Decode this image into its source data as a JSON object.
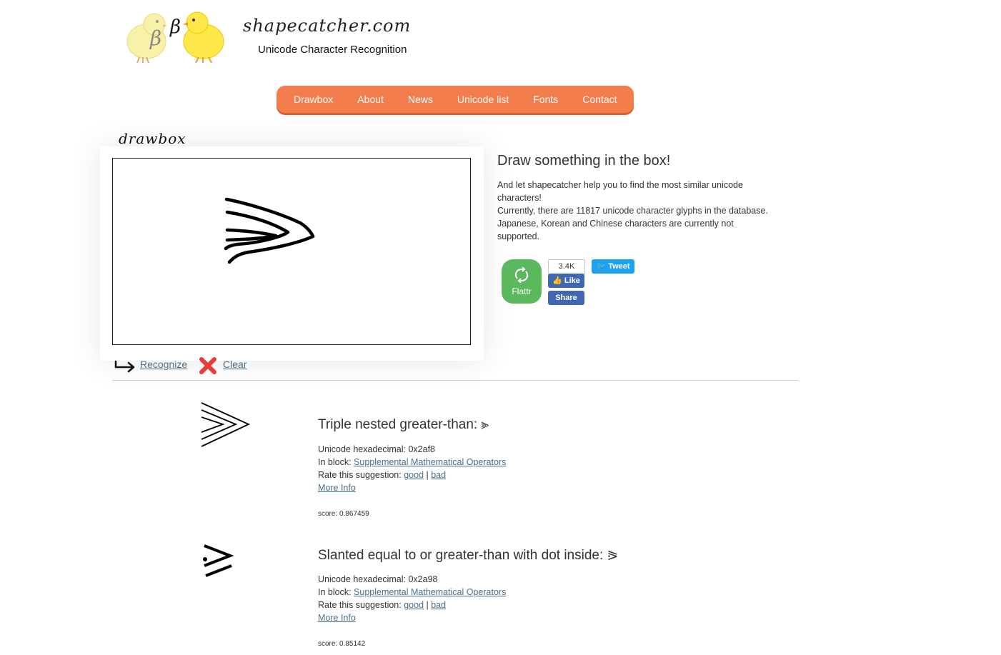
{
  "header": {
    "site_title": "shapecatcher.com",
    "subtitle": "Unicode Character Recognition",
    "logo_glyph": "β"
  },
  "nav": {
    "items": [
      "Drawbox",
      "About",
      "News",
      "Unicode list",
      "Fonts",
      "Contact"
    ],
    "color": "#f47d4e"
  },
  "drawbox": {
    "title": "drawbox",
    "recognize_label": "Recognize",
    "clear_label": "Clear"
  },
  "intro": {
    "heading": "Draw something in the box!",
    "lines": [
      "And let shapecatcher help you to find the most similar unicode",
      "characters!",
      "Currently, there are 11817 unicode character glyphs in the database.",
      "Japanese, Korean and Chinese characters are currently not",
      "supported."
    ]
  },
  "social": {
    "flattr_label": "Flattr",
    "fb_count": "3.4K",
    "fb_like": "Like",
    "fb_share": "Share",
    "tweet": "Tweet"
  },
  "results": [
    {
      "glyph": "⫸",
      "title": "Triple nested greater-than: ⫸",
      "hex_label": "Unicode hexadecimal: 0x2af8",
      "block_prefix": "In block: ",
      "block": "Supplemental Mathematical Operators",
      "rate_prefix": "Rate this suggestion: ",
      "good": "good",
      "separator": " | ",
      "bad": "bad",
      "more_info": "More Info ",
      "score": "score: 0.867459"
    },
    {
      "glyph": "⪘",
      "title": "Slanted equal to or greater-than with dot inside: ⪘",
      "hex_label": "Unicode hexadecimal: 0x2a98",
      "block_prefix": "In block: ",
      "block": "Supplemental Mathematical Operators",
      "rate_prefix": "Rate this suggestion: ",
      "good": "good",
      "separator": " | ",
      "bad": "bad",
      "more_info": "More Info ",
      "score": "score: 0.85142"
    }
  ]
}
